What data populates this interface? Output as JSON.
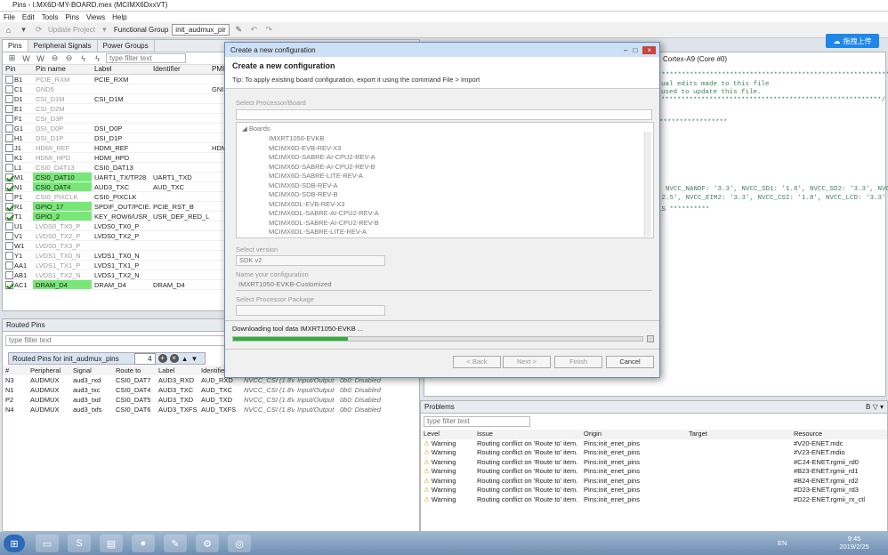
{
  "window": {
    "title": "Pins - I.MX6D-MY-BOARD.mex (MCIMX6DxxVT)"
  },
  "menu": [
    "File",
    "Edit",
    "Tools",
    "Pins",
    "Views",
    "Help"
  ],
  "toolbar": {
    "update_project": "Update Project",
    "functional_group_label": "Functional Group",
    "functional_group_value": "init_audmux_pir"
  },
  "cloud_button": "拖拽上传",
  "pins_tabs": [
    "Pins",
    "Peripheral Signals",
    "Power Groups"
  ],
  "pins_filter_placeholder": "type filter text",
  "pins_columns": [
    "Pin",
    "Pin name",
    "Label",
    "Identifier",
    "PMI"
  ],
  "pins_rows": [
    {
      "pin": "B1",
      "name": "PCIE_RXM",
      "label": "PCIE_RXM",
      "id": "",
      "pm": "",
      "grey": true,
      "green": false
    },
    {
      "pin": "C1",
      "name": "GND5",
      "label": "",
      "id": "",
      "pm": "GNI",
      "grey": true,
      "green": false
    },
    {
      "pin": "D1",
      "name": "CSI_D1M",
      "label": "CSI_D1M",
      "id": "",
      "pm": "",
      "grey": true,
      "green": false
    },
    {
      "pin": "E1",
      "name": "CSI_D2M",
      "label": "",
      "id": "",
      "pm": "",
      "grey": true,
      "green": false
    },
    {
      "pin": "F1",
      "name": "CSI_D3P",
      "label": "",
      "id": "",
      "pm": "",
      "grey": true,
      "green": false
    },
    {
      "pin": "G1",
      "name": "DSI_D0P",
      "label": "DSI_D0P",
      "id": "",
      "pm": "",
      "grey": true,
      "green": false
    },
    {
      "pin": "H1",
      "name": "DSI_D1P",
      "label": "DSI_D1P",
      "id": "",
      "pm": "",
      "grey": true,
      "green": false
    },
    {
      "pin": "J1",
      "name": "HDMI_REF",
      "label": "HDMI_REF",
      "id": "",
      "pm": "HDM",
      "grey": true,
      "green": false
    },
    {
      "pin": "K1",
      "name": "HDMI_HPD",
      "label": "HDMI_HPD",
      "id": "",
      "pm": "",
      "grey": true,
      "green": false
    },
    {
      "pin": "L1",
      "name": "CSI0_DAT13",
      "label": "CSI0_DAT13",
      "id": "",
      "pm": "",
      "grey": true,
      "green": false
    },
    {
      "pin": "M1",
      "name": "CSI0_DAT10",
      "label": "UART1_TX/TP28",
      "id": "UART1_TXD",
      "pm": "",
      "grey": false,
      "green": true
    },
    {
      "pin": "N1",
      "name": "CSI0_DAT4",
      "label": "AUD3_TXC",
      "id": "AUD_TXC",
      "pm": "",
      "grey": false,
      "green": true
    },
    {
      "pin": "P1",
      "name": "CSI0_PIXCLK",
      "label": "CSI0_PIXCLK",
      "id": "",
      "pm": "",
      "grey": true,
      "green": false
    },
    {
      "pin": "R1",
      "name": "GPIO_17",
      "label": "SPDIF_OUT/PCIE...",
      "id": "PCIE_RST_B",
      "pm": "",
      "grey": false,
      "green": true
    },
    {
      "pin": "T1",
      "name": "GPIO_2",
      "label": "KEY_ROW6/USR_...",
      "id": "USR_DEF_RED_L...",
      "pm": "",
      "grey": false,
      "green": true
    },
    {
      "pin": "U1",
      "name": "LVDS0_TX0_P",
      "label": "LVDS0_TX0_P",
      "id": "",
      "pm": "",
      "grey": true,
      "green": false
    },
    {
      "pin": "V1",
      "name": "LVDS0_TX2_P",
      "label": "LVDS0_TX2_P",
      "id": "",
      "pm": "",
      "grey": true,
      "green": false
    },
    {
      "pin": "W1",
      "name": "LVDS0_TX3_P",
      "label": "",
      "id": "",
      "pm": "",
      "grey": true,
      "green": false
    },
    {
      "pin": "Y1",
      "name": "LVDS1_TX0_N",
      "label": "LVDS1_TX0_N",
      "id": "",
      "pm": "",
      "grey": true,
      "green": false
    },
    {
      "pin": "AA1",
      "name": "LVDS1_TX1_P",
      "label": "LVDS1_TX1_P",
      "id": "",
      "pm": "",
      "grey": true,
      "green": false
    },
    {
      "pin": "AB1",
      "name": "LVDS1_TX2_N",
      "label": "LVDS1_TX2_N",
      "id": "",
      "pm": "",
      "grey": true,
      "green": false
    },
    {
      "pin": "AC1",
      "name": "DRAM_D4",
      "label": "DRAM_D4",
      "id": "DRAM_D4",
      "pm": "",
      "grey": false,
      "green": true
    }
  ],
  "routed": {
    "title": "Routed Pins",
    "filter_placeholder": "type filter text",
    "group_label": "Routed Pins for init_audmux_pins",
    "count": "4",
    "columns": [
      "#",
      "Peripheral",
      "Signal",
      "Route to",
      "Label",
      "Identifier"
    ],
    "rows": [
      {
        "n": "N3",
        "p": "AUDMUX",
        "s": "aud3_rxd",
        "r": "CSI0_DAT7",
        "l": "AUD3_RXD",
        "i": "AUD_RXD",
        "v": "NVCC_CSI (1.8V)",
        "d": "Input/Output",
        "m": "0b0: Disabled"
      },
      {
        "n": "N1",
        "p": "AUDMUX",
        "s": "aud3_txc",
        "r": "CSI0_DAT4",
        "l": "AUD3_TXC",
        "i": "AUD_TXC",
        "v": "NVCC_CSI (1.8V)",
        "d": "Input/Output",
        "m": "0b0: Disabled"
      },
      {
        "n": "P2",
        "p": "AUDMUX",
        "s": "aud3_txd",
        "r": "CSI0_DAT5",
        "l": "AUD3_TXD",
        "i": "AUD_TXD",
        "v": "NVCC_CSI (1.8V)",
        "d": "Input/Output",
        "m": "0b0: Disabled"
      },
      {
        "n": "N4",
        "p": "AUDMUX",
        "s": "aud3_txfs",
        "r": "CSI0_DAT6",
        "l": "AUD3_TXFS",
        "i": "AUD_TXFS",
        "v": "NVCC_CSI (1.8V)",
        "d": "Input/Output",
        "m": "0b0: Disabled"
      }
    ]
  },
  "editor": {
    "tab": "Cortex-A9 (Core #0)",
    "lines": [
      "************************************************************",
      "ual edits made to this file",
      " used to update this file.",
      "*******************************************************/",
      "*****************",
      ", NVCC_NANDF: '3.3', NVCC_SD1: '1.8', NVCC_SD2: '3.3', NVC",
      "'2.5', NVCC_EIM2: '3.3', NVCC_CSI: '1.8', NVCC_LCD: '3.3'",
      "LS **********"
    ]
  },
  "problems": {
    "title": "Problems",
    "filter_placeholder": "type filter text",
    "columns": [
      "Level",
      "Issue",
      "Origin",
      "Target",
      "Resource"
    ],
    "rows": [
      {
        "level": "Warning",
        "issue": "Routing conflict on 'Route to' item.",
        "origin": "Pins:init_enet_pins",
        "resource": "#V20-ENET.mdc"
      },
      {
        "level": "Warning",
        "issue": "Routing conflict on 'Route to' item.",
        "origin": "Pins:init_enet_pins",
        "resource": "#V23-ENET.mdio"
      },
      {
        "level": "Warning",
        "issue": "Routing conflict on 'Route to' item.",
        "origin": "Pins:init_enet_pins",
        "resource": "#C24-ENET.rgmii_rd0"
      },
      {
        "level": "Warning",
        "issue": "Routing conflict on 'Route to' item.",
        "origin": "Pins:init_enet_pins",
        "resource": "#B23-ENET.rgmii_rd1"
      },
      {
        "level": "Warning",
        "issue": "Routing conflict on 'Route to' item.",
        "origin": "Pins:init_enet_pins",
        "resource": "#B24-ENET.rgmii_rd2"
      },
      {
        "level": "Warning",
        "issue": "Routing conflict on 'Route to' item.",
        "origin": "Pins:init_enet_pins",
        "resource": "#D23-ENET.rgmii_rd3"
      },
      {
        "level": "Warning",
        "issue": "Routing conflict on 'Route to' item.",
        "origin": "Pins:init_enet_pins",
        "resource": "#D22-ENET.rgmii_rx_ctl"
      }
    ]
  },
  "dialog": {
    "window_title": "Create a new configuration",
    "heading": "Create a new configuration",
    "tip": "Tip: To apply existing board configuration, export it using the command File > Import",
    "select_processor_board": "Select Processor/Board",
    "boards_label": "Boards",
    "boards": [
      "IMXRT1050-EVKB",
      "MCIMX6D-EVB-REV-X3",
      "MCIMX6D-SABRE-AI-CPU2-REV-A",
      "MCIMX6D-SABRE-AI-CPU2-REV-B",
      "MCIMX6D-SABRE-LITE-REV-A",
      "MCIMX6D-SDB-REV-A",
      "MCIMX6D-SDB-REV-B",
      "MCIMX6DL-EVB-REV-X3",
      "MCIMX6DL-SABRE-AI-CPU2-REV-A",
      "MCIMX6DL-SABRE-AI-CPU2-REV-B",
      "MCIMX6DL-SABRE-LITE-REV-A",
      "MCIMX6DL-SDB-REV-A"
    ],
    "select_version": "Select version",
    "version_value": "SDK v2",
    "name_label": "Name your configuration",
    "name_value": "IMXRT1050-EVKB-Customized",
    "package_label": "Select Processor Package",
    "status": "Downloading tool data IMXRT1050-EVKB ...",
    "progress": 0.28,
    "buttons": {
      "back": "< Back",
      "next": "Next >",
      "finish": "Finish",
      "cancel": "Cancel"
    }
  },
  "taskbar": {
    "lang": "EN",
    "time": "9:45",
    "date": "2019/2/25"
  }
}
